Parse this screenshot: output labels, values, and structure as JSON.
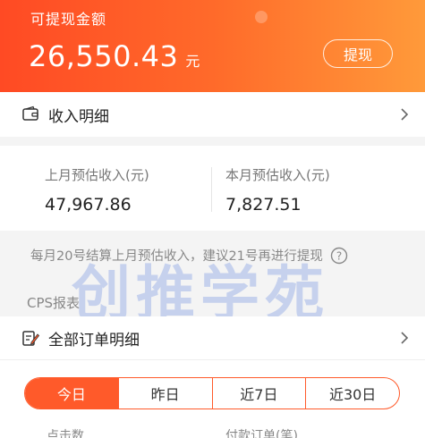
{
  "balance": {
    "label": "可提现金额",
    "amount": "26,550.43",
    "unit": "元",
    "withdraw_label": "提现"
  },
  "income_detail": {
    "label": "收入明细"
  },
  "estimates": {
    "last_month_title": "上月预估收入(元)",
    "last_month_value": "47,967.86",
    "this_month_title": "本月预估收入(元)",
    "this_month_value": "7,827.51"
  },
  "notice": {
    "text": "每月20号结算上月预估收入，建议21号再进行提现"
  },
  "cps": {
    "title": "CPS报表"
  },
  "all_orders": {
    "label": "全部订单明细"
  },
  "tabs": [
    {
      "label": "今日",
      "active": true
    },
    {
      "label": "昨日",
      "active": false
    },
    {
      "label": "近7日",
      "active": false
    },
    {
      "label": "近30日",
      "active": false
    }
  ],
  "bottom": {
    "left_label": "点击数",
    "right_label": "付款订单(笔)"
  },
  "watermark": {
    "text": "创推学苑"
  },
  "colors": {
    "accent": "#ff5a2a",
    "gradient_start": "#ff4a24",
    "gradient_end": "#ff9a3a"
  }
}
